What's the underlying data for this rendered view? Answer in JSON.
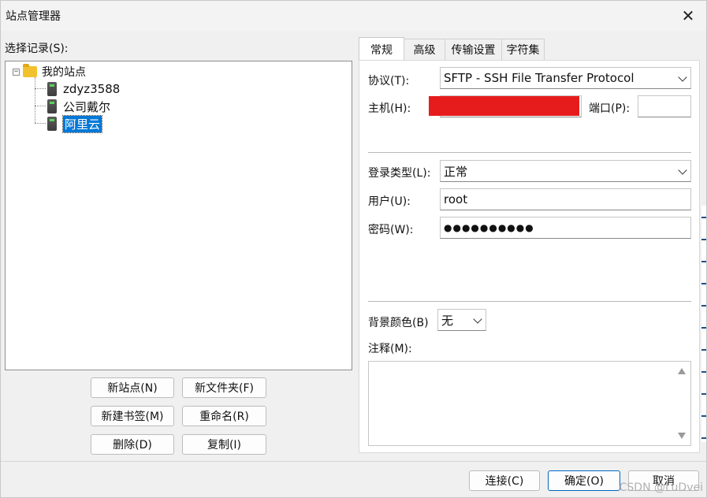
{
  "window": {
    "title": "站点管理器"
  },
  "left": {
    "select_label": "选择记录(S):",
    "tree": {
      "root": "我的站点",
      "items": [
        "zdyz3588",
        "公司戴尔",
        "阿里云"
      ],
      "selected_index": 2
    },
    "buttons": {
      "new_site": "新站点(N)",
      "new_folder": "新文件夹(F)",
      "new_bookmark": "新建书签(M)",
      "rename": "重命名(R)",
      "delete": "删除(D)",
      "copy": "复制(I)"
    }
  },
  "tabs": [
    "常规",
    "高级",
    "传输设置",
    "字符集"
  ],
  "active_tab": 0,
  "general": {
    "protocol_label": "协议(T):",
    "protocol_value": "SFTP - SSH File Transfer Protocol",
    "host_label": "主机(H):",
    "port_label": "端口(P):",
    "port_value": "",
    "logon_type_label": "登录类型(L):",
    "logon_type_value": "正常",
    "user_label": "用户(U):",
    "user_value": "root",
    "password_label": "密码(W):",
    "password_value": "●●●●●●●●●●",
    "bgcolor_label": "背景颜色(B)",
    "bgcolor_value": "无",
    "comments_label": "注释(M):",
    "comments_value": ""
  },
  "footer": {
    "connect": "连接(C)",
    "ok": "确定(O)",
    "cancel": "取消"
  },
  "watermark": "CSDN @LuDvei",
  "colors": {
    "selection": "#0078d7",
    "redaction": "#e61c1c",
    "folder": "#f2c12e"
  },
  "icons": {
    "close": "close-icon",
    "folder": "folder-icon",
    "server": "server-icon",
    "dropdown": "chevron-down-icon"
  }
}
